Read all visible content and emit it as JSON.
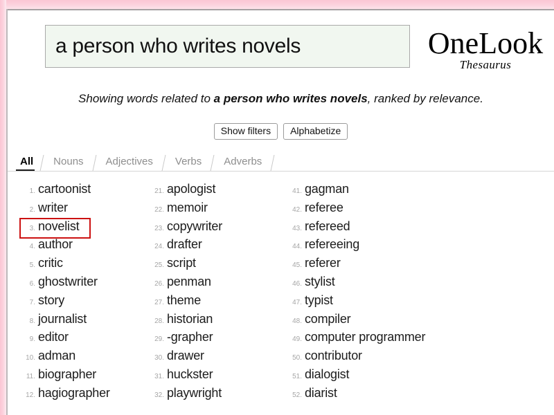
{
  "frame": {
    "accent_pink": "#fbc6d4",
    "border_gray": "#a5a0a2"
  },
  "header": {
    "search": {
      "value": "a person who writes novels",
      "placeholder": "Enter a word, phrase, or description"
    },
    "logo": {
      "main": "OneLook",
      "sub": "Thesaurus"
    }
  },
  "subtitle": {
    "prefix": "Showing words related to ",
    "query": "a person who writes novels",
    "suffix": ", ranked by relevance."
  },
  "buttons": {
    "show_filters": "Show filters",
    "alphabetize": "Alphabetize"
  },
  "tabs": [
    {
      "label": "All",
      "active": true
    },
    {
      "label": "Nouns",
      "active": false
    },
    {
      "label": "Adjectives",
      "active": false
    },
    {
      "label": "Verbs",
      "active": false
    },
    {
      "label": "Adverbs",
      "active": false
    }
  ],
  "results": {
    "highlight_color": "#cc1111",
    "columns": [
      {
        "items": [
          {
            "num": "1.",
            "word": "cartoonist",
            "highlighted": false
          },
          {
            "num": "2.",
            "word": "writer",
            "highlighted": false
          },
          {
            "num": "3.",
            "word": "novelist",
            "highlighted": true
          },
          {
            "num": "4.",
            "word": "author",
            "highlighted": false
          },
          {
            "num": "5.",
            "word": "critic",
            "highlighted": false
          },
          {
            "num": "6.",
            "word": "ghostwriter",
            "highlighted": false
          },
          {
            "num": "7.",
            "word": "story",
            "highlighted": false
          },
          {
            "num": "8.",
            "word": "journalist",
            "highlighted": false
          },
          {
            "num": "9.",
            "word": "editor",
            "highlighted": false
          },
          {
            "num": "10.",
            "word": "adman",
            "highlighted": false
          },
          {
            "num": "11.",
            "word": "biographer",
            "highlighted": false
          },
          {
            "num": "12.",
            "word": "hagiographer",
            "highlighted": false
          }
        ]
      },
      {
        "items": [
          {
            "num": "21.",
            "word": "apologist",
            "highlighted": false
          },
          {
            "num": "22.",
            "word": "memoir",
            "highlighted": false
          },
          {
            "num": "23.",
            "word": "copywriter",
            "highlighted": false
          },
          {
            "num": "24.",
            "word": "drafter",
            "highlighted": false
          },
          {
            "num": "25.",
            "word": "script",
            "highlighted": false
          },
          {
            "num": "26.",
            "word": "penman",
            "highlighted": false
          },
          {
            "num": "27.",
            "word": "theme",
            "highlighted": false
          },
          {
            "num": "28.",
            "word": "historian",
            "highlighted": false
          },
          {
            "num": "29.",
            "word": "-grapher",
            "highlighted": false
          },
          {
            "num": "30.",
            "word": "drawer",
            "highlighted": false
          },
          {
            "num": "31.",
            "word": "huckster",
            "highlighted": false
          },
          {
            "num": "32.",
            "word": "playwright",
            "highlighted": false
          }
        ]
      },
      {
        "items": [
          {
            "num": "41.",
            "word": "gagman",
            "highlighted": false
          },
          {
            "num": "42.",
            "word": "referee",
            "highlighted": false
          },
          {
            "num": "43.",
            "word": "refereed",
            "highlighted": false
          },
          {
            "num": "44.",
            "word": "refereeing",
            "highlighted": false
          },
          {
            "num": "45.",
            "word": "referer",
            "highlighted": false
          },
          {
            "num": "46.",
            "word": "stylist",
            "highlighted": false
          },
          {
            "num": "47.",
            "word": "typist",
            "highlighted": false
          },
          {
            "num": "48.",
            "word": "compiler",
            "highlighted": false
          },
          {
            "num": "49.",
            "word": "computer programmer",
            "highlighted": false
          },
          {
            "num": "50.",
            "word": "contributor",
            "highlighted": false
          },
          {
            "num": "51.",
            "word": "dialogist",
            "highlighted": false
          },
          {
            "num": "52.",
            "word": "diarist",
            "highlighted": false
          }
        ]
      }
    ]
  }
}
